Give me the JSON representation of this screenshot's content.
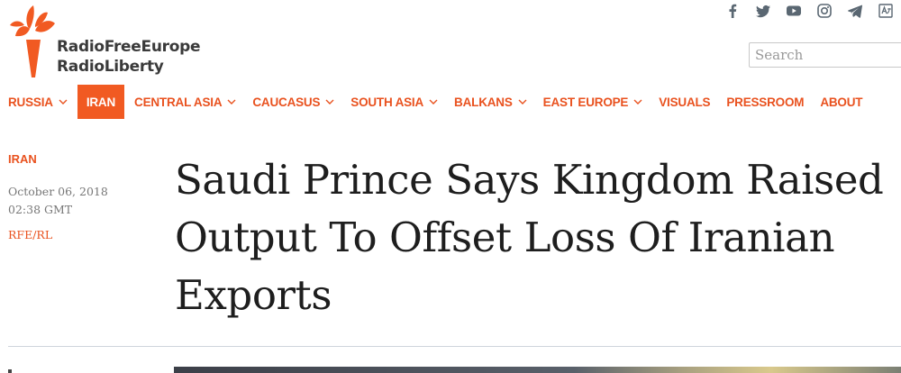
{
  "brand": {
    "line1": "RadioFreeEurope",
    "line2": "RadioLiberty",
    "logo_icon": "torch-icon",
    "accent": "#f15a22"
  },
  "social": [
    "facebook-icon",
    "twitter-icon",
    "youtube-icon",
    "instagram-icon",
    "telegram-icon",
    "language-icon"
  ],
  "search": {
    "placeholder": "Search",
    "value": ""
  },
  "nav": [
    {
      "label": "RUSSIA",
      "dropdown": true,
      "active": false
    },
    {
      "label": "IRAN",
      "dropdown": false,
      "active": true
    },
    {
      "label": "CENTRAL ASIA",
      "dropdown": true,
      "active": false
    },
    {
      "label": "CAUCASUS",
      "dropdown": true,
      "active": false
    },
    {
      "label": "SOUTH ASIA",
      "dropdown": true,
      "active": false
    },
    {
      "label": "BALKANS",
      "dropdown": true,
      "active": false
    },
    {
      "label": "EAST EUROPE",
      "dropdown": true,
      "active": false
    },
    {
      "label": "VISUALS",
      "dropdown": false,
      "active": false
    },
    {
      "label": "PRESSROOM",
      "dropdown": false,
      "active": false
    },
    {
      "label": "ABOUT",
      "dropdown": false,
      "active": false
    }
  ],
  "article": {
    "section": "IRAN",
    "date": "October 06, 2018",
    "time": "02:38 GMT",
    "source": "RFE/RL",
    "headline": "Saudi Prince Says Kingdom Raised Output To Offset Loss Of Iranian Exports"
  }
}
